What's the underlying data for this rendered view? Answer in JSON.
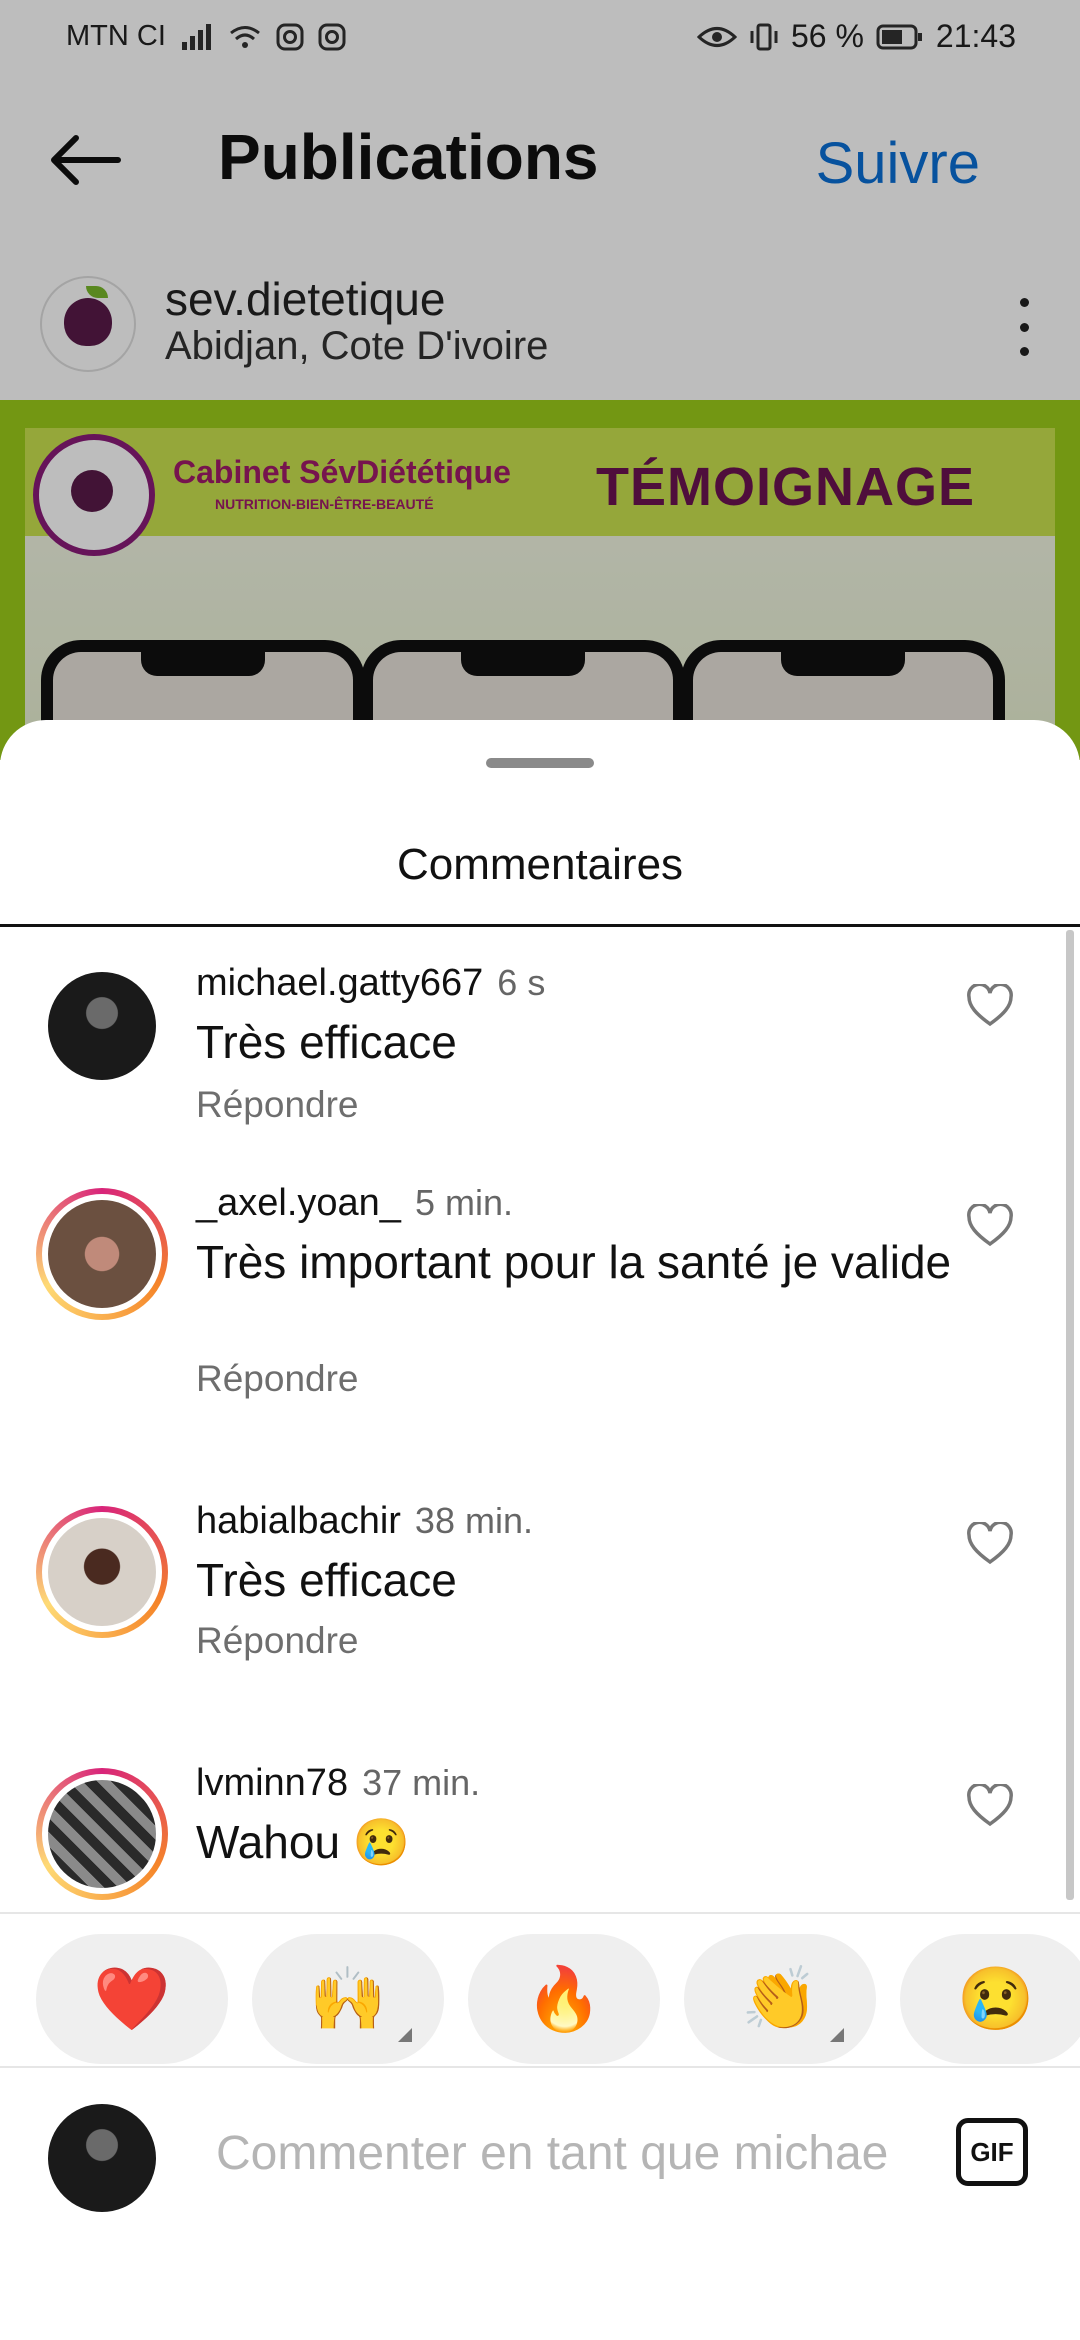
{
  "status_bar": {
    "carrier": "MTN CI",
    "battery": "56 %",
    "time": "21:43"
  },
  "header": {
    "title": "Publications",
    "follow_label": "Suivre"
  },
  "profile": {
    "username": "sev.dietetique",
    "location": "Abidjan, Cote D'ivoire"
  },
  "post": {
    "banner_title": "Cabinet SévDiététique",
    "banner_subtitle": "NUTRITION-BIEN-ÊTRE-BEAUTÉ",
    "banner_label": "TÉMOIGNAGE"
  },
  "sheet": {
    "title": "Commentaires"
  },
  "comments": [
    {
      "username": "michael.gatty667",
      "time": "6 s",
      "text": "Très efficace",
      "reply": "Répondre"
    },
    {
      "username": "_axel.yoan_",
      "time": "5 min.",
      "text": "Très important pour la santé je valide",
      "reply": "Répondre"
    },
    {
      "username": "habialbachir",
      "time": "38 min.",
      "text": "Très efficace",
      "reply": "Répondre"
    },
    {
      "username": "lvminn78",
      "time": "37 min.",
      "text": "Wahou 😢"
    }
  ],
  "reactions": [
    "❤️",
    "🙌",
    "🔥",
    "👏",
    "😢"
  ],
  "composer": {
    "placeholder": "Commenter en tant que michae",
    "gif_label": "GIF"
  },
  "colors": {
    "accent": "#0a6fd6",
    "post_green": "#9ccc1a",
    "brand_purple": "#8a1b79"
  }
}
